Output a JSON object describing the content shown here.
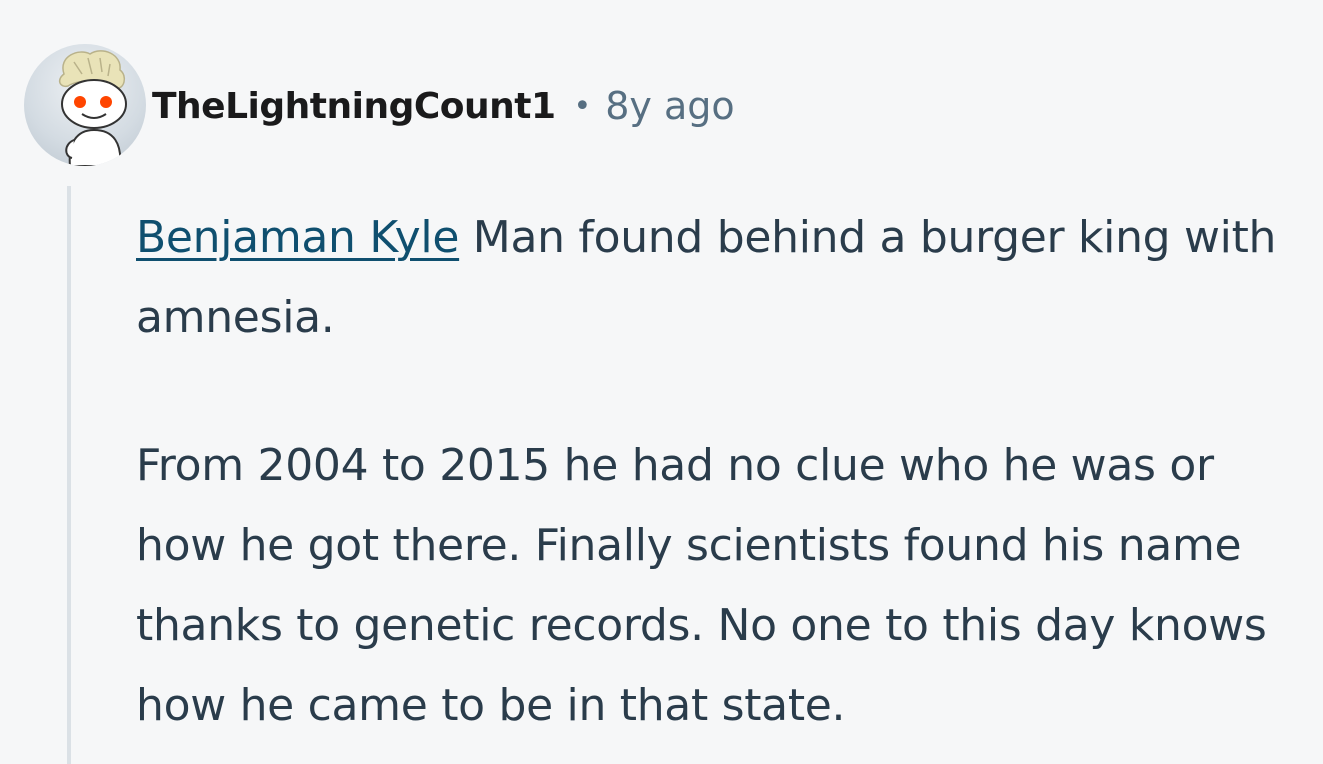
{
  "comment": {
    "author": "TheLightningCount1",
    "separator": "•",
    "timestamp": "8y ago",
    "avatar_icon": "reddit-snoo-avatar-icon",
    "body": {
      "paragraph1": {
        "link_text": "Benjaman Kyle",
        "text": " Man found behind a burger king with amnesia."
      },
      "paragraph2": "From 2004 to 2015 he had no clue who he was or how he got there. Finally scientists found his name thanks to genetic records. No one to this day knows how he came to be in that state."
    }
  },
  "colors": {
    "background": "#f6f7f8",
    "username": "#1a1a1b",
    "meta": "#576f82",
    "body_text": "#2a3c4b",
    "link": "#0f4f6f",
    "thread_line": "#dbe1e6"
  }
}
